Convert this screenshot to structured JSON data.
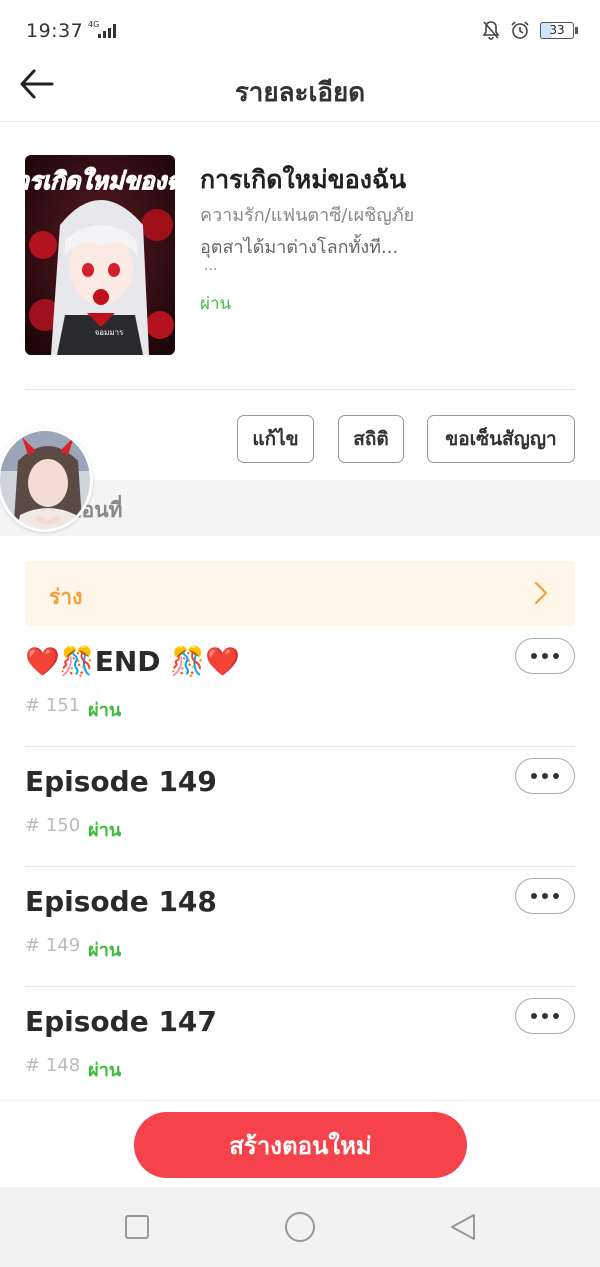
{
  "status_bar": {
    "time": "19:37",
    "network": "4G",
    "battery": "33"
  },
  "header": {
    "title": "รายละเอียด"
  },
  "book": {
    "title": "การเกิดใหม่ของฉัน",
    "genres": "ความรัก/แฟนตาซี/เผชิญภัย",
    "description": "อุตสาได้มาต่างโลกทั้งที...",
    "ellipsis": "...",
    "status": "ผ่าน",
    "cover_text": "การเกิดใหม่ของฉัน",
    "cover_sign": "จอมมาร"
  },
  "actions": {
    "edit": "แก้ไข",
    "stats": "สถิติ",
    "contract": "ขอเซ็นสัญญา"
  },
  "section": {
    "label": "ตอนที่"
  },
  "draft": {
    "label": "ร่าง"
  },
  "episodes": [
    {
      "title": "❤️🎊END 🎊❤️",
      "number": "# 151",
      "status": "ผ่าน"
    },
    {
      "title": "Episode 149",
      "number": "# 150",
      "status": "ผ่าน"
    },
    {
      "title": "Episode 148",
      "number": "# 149",
      "status": "ผ่าน"
    },
    {
      "title": "Episode 147",
      "number": "# 148",
      "status": "ผ่าน"
    }
  ],
  "create_button": "สร้างตอนใหม่",
  "colors": {
    "accent": "#f5424b",
    "pass": "#3dbd3d",
    "draft": "#f0a23a"
  }
}
